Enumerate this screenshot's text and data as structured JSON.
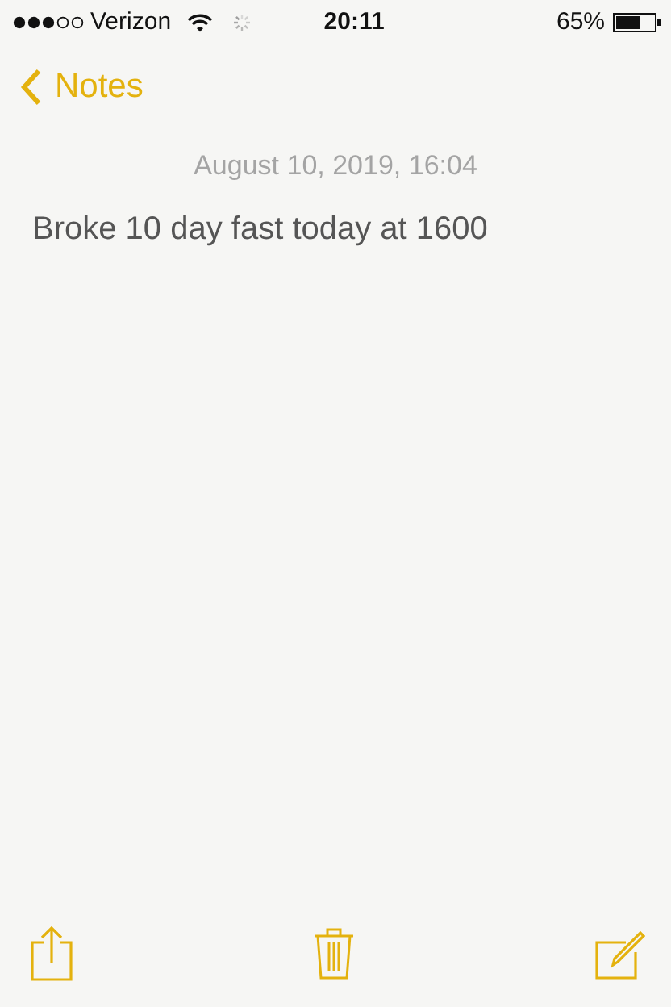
{
  "status_bar": {
    "carrier": "Verizon",
    "time": "20:11",
    "battery": "65%"
  },
  "nav_bar": {
    "back": "Notes"
  },
  "note": {
    "date": "August 10, 2019, 16:04",
    "text": "Broke 10 day fast today at 1600"
  }
}
